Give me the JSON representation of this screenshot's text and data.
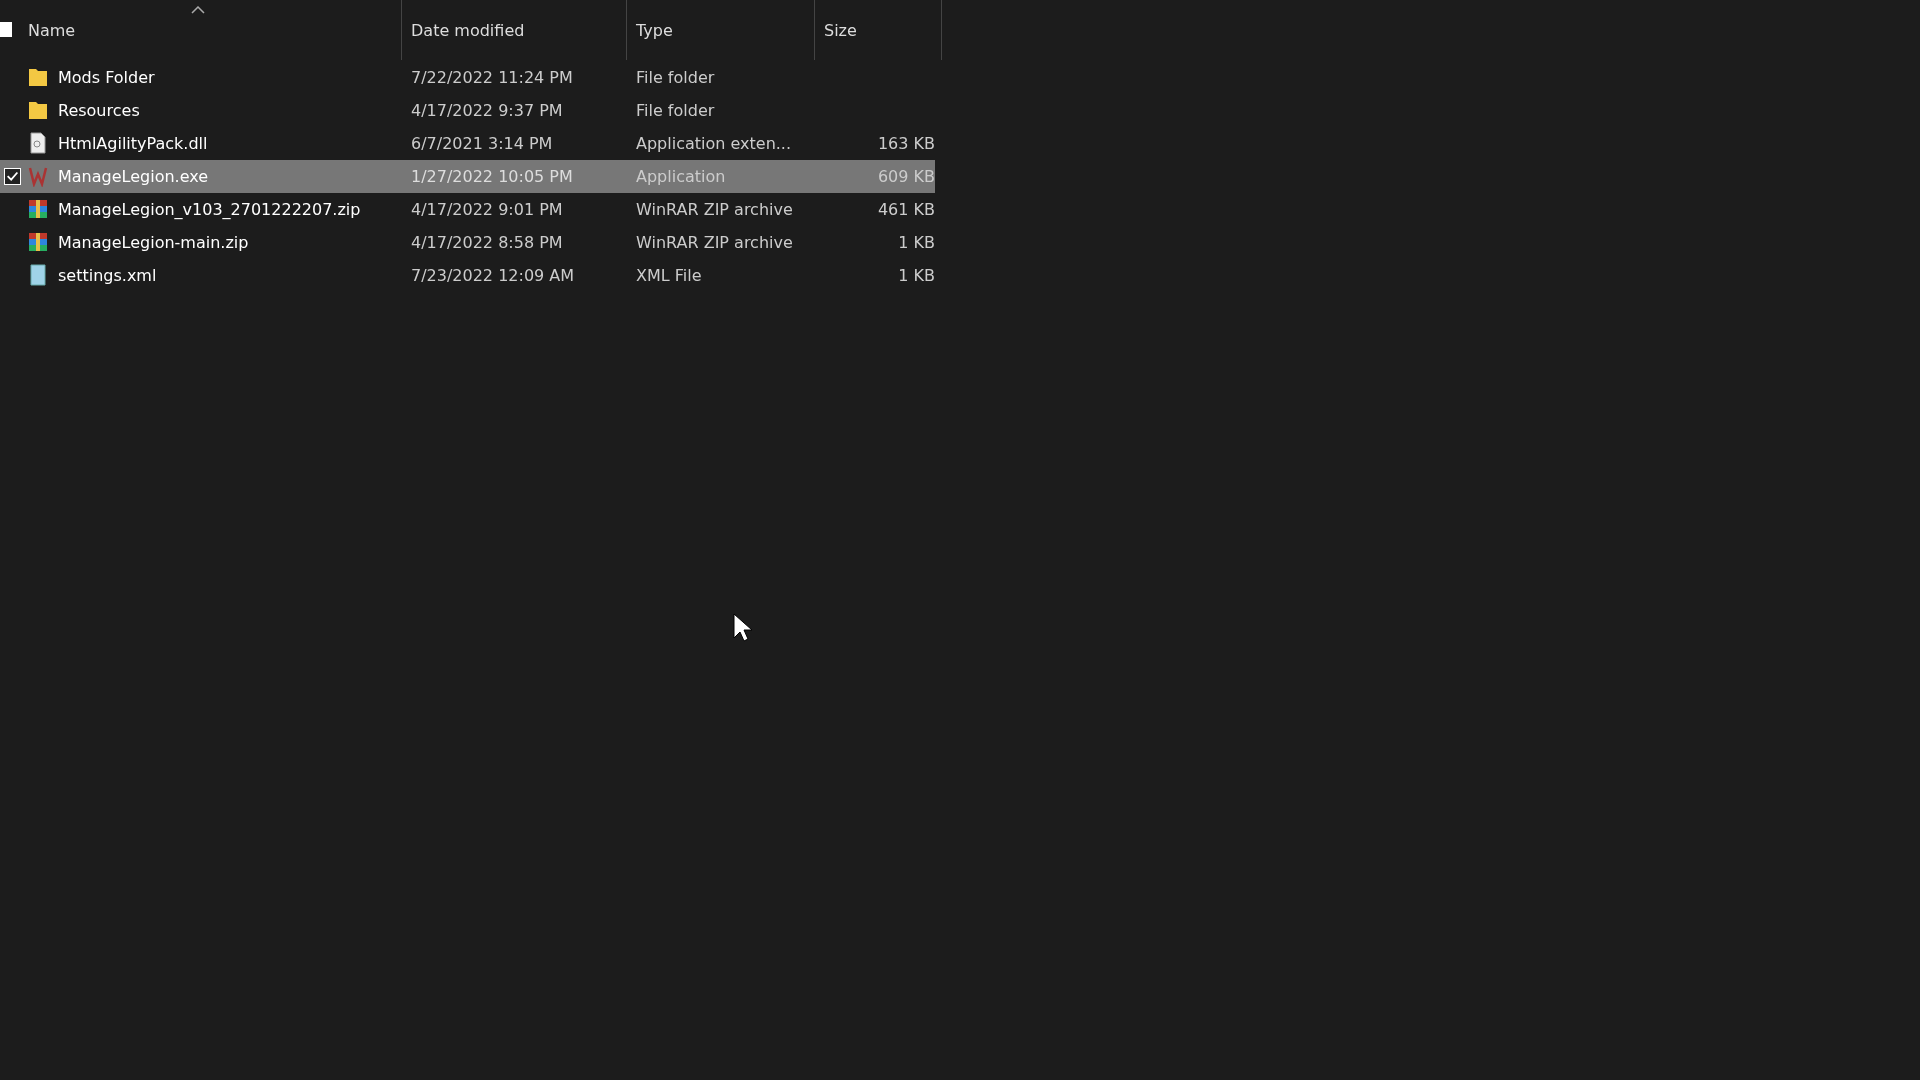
{
  "header": {
    "select_all_checked": false,
    "columns": [
      {
        "label": "Name",
        "sorted": true
      },
      {
        "label": "Date modified",
        "sorted": false
      },
      {
        "label": "Type",
        "sorted": false
      },
      {
        "label": "Size",
        "sorted": false
      }
    ]
  },
  "files": [
    {
      "kind": "folder",
      "name": "Mods Folder",
      "date": "7/22/2022 11:24 PM",
      "type": "File folder",
      "selected": false
    },
    {
      "kind": "folder",
      "name": "Resources",
      "date": "4/17/2022 9:37 PM",
      "type": "File folder",
      "selected": false
    },
    {
      "kind": "dll",
      "name": "HtmlAgilityPack.dll",
      "date": "6/7/2021 3:14 PM",
      "type": "Application exten...",
      "size": "163 KB",
      "selected": false
    },
    {
      "kind": "exe",
      "name": "ManageLegion.exe",
      "date": "1/27/2022 10:05 PM",
      "type": "Application",
      "size": "609 KB",
      "selected": true
    },
    {
      "kind": "zip",
      "name": "ManageLegion_v103_2701222207.zip",
      "date": "4/17/2022 9:01 PM",
      "type": "WinRAR ZIP archive",
      "size": "461 KB",
      "selected": false
    },
    {
      "kind": "zip",
      "name": "ManageLegion-main.zip",
      "date": "4/17/2022 8:58 PM",
      "type": "WinRAR ZIP archive",
      "size": "1 KB",
      "selected": false
    },
    {
      "kind": "xml",
      "name": "settings.xml",
      "date": "7/23/2022 12:09 AM",
      "type": "XML File",
      "size": "1 KB",
      "selected": false
    }
  ]
}
